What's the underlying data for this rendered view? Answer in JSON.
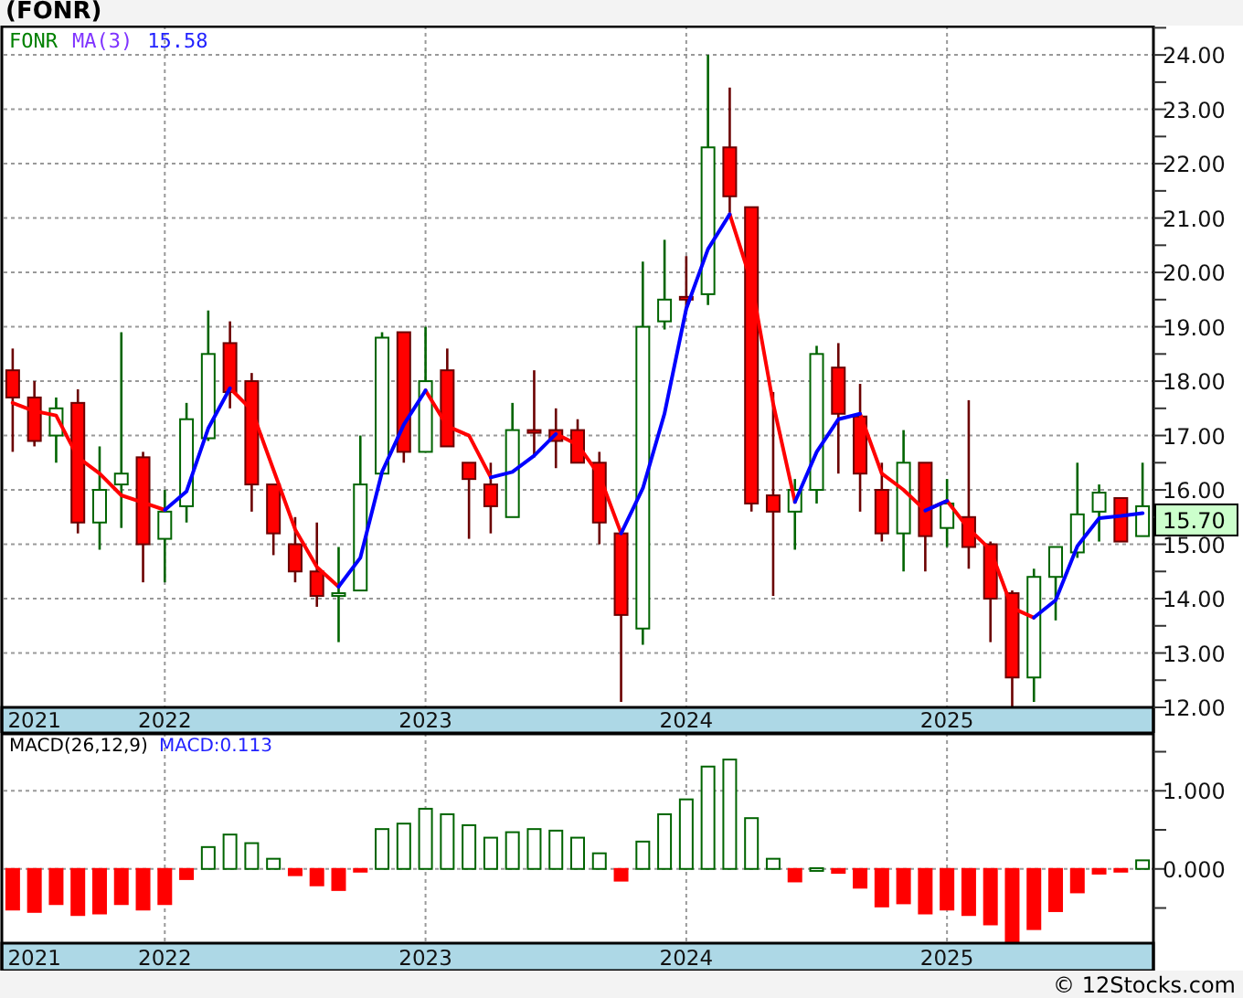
{
  "title": "(FONR)",
  "price_panel": {
    "symbol": "FONR",
    "ma_value": "15.58",
    "last_price": "15.70",
    "chart_data": {
      "type": "candlestick",
      "grid": true,
      "ylim": [
        12,
        24.54
      ],
      "categories": [
        null,
        "2021",
        null,
        null,
        null,
        null,
        null,
        "2022",
        null,
        null,
        null,
        null,
        null,
        null,
        null,
        null,
        null,
        null,
        null,
        "2023",
        null,
        null,
        null,
        null,
        null,
        null,
        null,
        null,
        null,
        null,
        null,
        "2024",
        null,
        null,
        null,
        null,
        null,
        null,
        null,
        null,
        null,
        null,
        null,
        "2025",
        null,
        null,
        null,
        null,
        null,
        null,
        null,
        null,
        null
      ],
      "yticks": [
        {
          "value": 12,
          "label": "12.00"
        },
        {
          "value": 13,
          "label": "13.00"
        },
        {
          "value": 14,
          "label": "14.00"
        },
        {
          "value": 15,
          "label": "15.00"
        },
        {
          "value": 16,
          "label": "16.00"
        },
        {
          "value": 17,
          "label": "17.00"
        },
        {
          "value": 18,
          "label": "18.00"
        },
        {
          "value": 19,
          "label": "19.00"
        },
        {
          "value": 20,
          "label": "20.00"
        },
        {
          "value": 21,
          "label": "21.00"
        },
        {
          "value": 22,
          "label": "22.00"
        },
        {
          "value": 23,
          "label": "23.00"
        },
        {
          "value": 24,
          "label": "24.00"
        }
      ],
      "ohlc": [
        [
          18.2,
          18.6,
          16.7,
          17.7
        ],
        [
          17.7,
          18.0,
          16.8,
          16.9
        ],
        [
          17.0,
          17.7,
          16.5,
          17.5
        ],
        [
          17.6,
          17.85,
          15.2,
          15.4
        ],
        [
          15.4,
          16.8,
          14.9,
          16.0
        ],
        [
          16.1,
          18.9,
          15.3,
          16.3
        ],
        [
          16.6,
          16.7,
          14.3,
          15.0
        ],
        [
          15.1,
          16.0,
          14.3,
          15.6
        ],
        [
          15.7,
          17.6,
          15.4,
          17.3
        ],
        [
          16.95,
          19.3,
          16.9,
          18.5
        ],
        [
          18.7,
          19.1,
          17.5,
          17.8
        ],
        [
          18.0,
          18.15,
          15.6,
          16.1
        ],
        [
          16.1,
          16.1,
          14.8,
          15.2
        ],
        [
          15.0,
          15.5,
          14.3,
          14.5
        ],
        [
          14.5,
          15.4,
          13.85,
          14.05
        ],
        [
          14.05,
          14.95,
          13.2,
          14.1
        ],
        [
          14.15,
          17.0,
          14.15,
          16.1
        ],
        [
          16.3,
          18.9,
          16.3,
          18.8
        ],
        [
          18.9,
          18.9,
          16.5,
          16.7
        ],
        [
          16.7,
          19.0,
          16.7,
          18.0
        ],
        [
          18.2,
          18.6,
          16.8,
          16.8
        ],
        [
          16.5,
          16.5,
          15.1,
          16.2
        ],
        [
          16.1,
          16.5,
          15.2,
          15.7
        ],
        [
          15.5,
          17.6,
          15.5,
          17.1
        ],
        [
          17.1,
          18.2,
          16.6,
          17.05
        ],
        [
          17.1,
          17.5,
          16.4,
          16.9
        ],
        [
          17.1,
          17.3,
          16.5,
          16.5
        ],
        [
          16.5,
          16.7,
          15.0,
          15.4
        ],
        [
          15.2,
          15.2,
          12.1,
          13.7
        ],
        [
          13.45,
          20.2,
          13.15,
          19.0
        ],
        [
          19.1,
          20.6,
          18.95,
          19.5
        ],
        [
          19.55,
          20.3,
          19.3,
          19.5
        ],
        [
          19.6,
          24.0,
          19.4,
          22.3
        ],
        [
          22.3,
          23.4,
          21.1,
          21.4
        ],
        [
          21.2,
          21.2,
          15.6,
          15.75
        ],
        [
          15.9,
          17.8,
          14.05,
          15.6
        ],
        [
          15.6,
          16.2,
          14.9,
          16.0
        ],
        [
          16.0,
          18.65,
          15.75,
          18.5
        ],
        [
          18.25,
          18.7,
          16.3,
          17.4
        ],
        [
          17.35,
          17.95,
          15.6,
          16.3
        ],
        [
          16.0,
          16.5,
          15.05,
          15.2
        ],
        [
          15.2,
          17.1,
          14.5,
          16.5
        ],
        [
          16.5,
          16.5,
          14.5,
          15.15
        ],
        [
          15.3,
          16.2,
          14.95,
          15.75
        ],
        [
          15.5,
          17.65,
          14.55,
          14.95
        ],
        [
          15.0,
          15.05,
          13.2,
          14.0
        ],
        [
          14.1,
          14.15,
          12.0,
          12.55
        ],
        [
          12.55,
          14.55,
          12.1,
          14.4
        ],
        [
          14.4,
          14.95,
          13.6,
          14.95
        ],
        [
          14.85,
          16.5,
          14.75,
          15.55
        ],
        [
          15.6,
          16.1,
          15.05,
          15.95
        ],
        [
          15.85,
          15.85,
          15.05,
          15.05
        ],
        [
          15.15,
          16.5,
          15.15,
          15.7
        ]
      ],
      "series": [
        {
          "type": "line",
          "color": "#ff0000",
          "values": [
            17.6,
            17.45,
            17.37,
            16.6,
            16.3,
            15.9,
            15.77,
            15.63,
            null,
            null,
            17.87,
            17.47,
            16.37,
            15.27,
            14.58,
            14.22,
            null,
            null,
            null,
            17.83,
            17.17,
            17.0,
            16.23,
            null,
            null,
            17.03,
            16.83,
            16.27,
            15.2,
            null,
            null,
            null,
            null,
            21.07,
            19.82,
            17.58,
            15.78,
            null,
            null,
            17.4,
            16.3,
            16.0,
            15.62,
            15.8,
            15.28,
            14.9,
            13.83,
            13.65,
            null,
            null,
            null,
            null,
            null
          ]
        },
        {
          "name": "MA(3)",
          "type": "line",
          "color": "#0000ff",
          "values": [
            null,
            null,
            null,
            null,
            null,
            null,
            null,
            15.63,
            15.97,
            17.13,
            17.87,
            null,
            null,
            null,
            null,
            14.22,
            14.75,
            16.33,
            17.2,
            17.83,
            null,
            null,
            16.23,
            16.33,
            16.63,
            17.03,
            null,
            null,
            15.2,
            16.03,
            17.4,
            19.33,
            20.43,
            21.07,
            null,
            null,
            15.78,
            16.7,
            17.3,
            17.4,
            null,
            null,
            15.62,
            15.8,
            null,
            null,
            null,
            13.65,
            13.97,
            14.97,
            15.48,
            15.52,
            15.57
          ]
        }
      ]
    }
  },
  "macd_panel": {
    "value_label": "MACD:0.113",
    "chart_data": {
      "type": "bar",
      "grid": true,
      "ylim": [
        -0.95,
        1.74
      ],
      "categories": [
        null,
        "2021",
        null,
        null,
        null,
        null,
        null,
        "2022",
        null,
        null,
        null,
        null,
        null,
        null,
        null,
        null,
        null,
        null,
        null,
        "2023",
        null,
        null,
        null,
        null,
        null,
        null,
        null,
        null,
        null,
        null,
        null,
        "2024",
        null,
        null,
        null,
        null,
        null,
        null,
        null,
        null,
        null,
        null,
        null,
        "2025",
        null,
        null,
        null,
        null,
        null,
        null,
        null,
        null,
        null
      ],
      "yticks": [
        {
          "value": 0,
          "label": "0.000"
        },
        {
          "value": 1,
          "label": "1.000"
        }
      ],
      "series": [
        {
          "name": "MACD(26,12,9)",
          "values": [
            -0.52,
            -0.55,
            -0.45,
            -0.59,
            -0.57,
            -0.45,
            -0.52,
            -0.45,
            -0.13,
            0.28,
            0.44,
            0.33,
            0.13,
            -0.08,
            -0.21,
            -0.27,
            -0.01,
            0.51,
            0.58,
            0.77,
            0.7,
            0.56,
            0.4,
            0.47,
            0.51,
            0.49,
            0.4,
            0.2,
            -0.15,
            0.35,
            0.7,
            0.89,
            1.31,
            1.4,
            0.65,
            0.13,
            -0.16,
            0.01,
            -0.05,
            -0.24,
            -0.48,
            -0.44,
            -0.57,
            -0.52,
            -0.59,
            -0.71,
            -0.93,
            -0.77,
            -0.54,
            -0.3,
            -0.06,
            -0.02,
            0.11
          ]
        }
      ]
    }
  },
  "footer": "© 12Stocks.com"
}
